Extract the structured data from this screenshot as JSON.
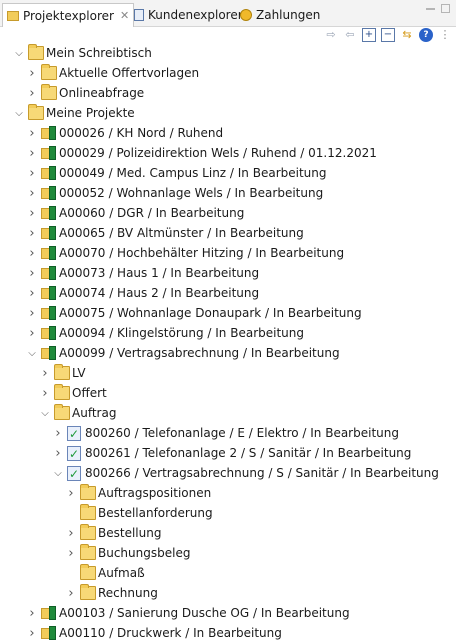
{
  "tabs": [
    {
      "label": "Projektexplorer",
      "active": true,
      "icon": "project-explorer-icon",
      "closable": true
    },
    {
      "label": "Kundenexplorer",
      "active": false,
      "icon": "customer-explorer-icon"
    },
    {
      "label": "Zahlungen",
      "active": false,
      "icon": "payments-icon"
    }
  ],
  "toolbar": {
    "icons": [
      "forward-arrow-icon",
      "back-arrow-icon",
      "expand-all-icon",
      "collapse-all-icon",
      "link-editor-icon",
      "help-icon",
      "view-menu-icon"
    ]
  },
  "tree": [
    {
      "level": 0,
      "expanded": true,
      "icon": "folder-open",
      "label": "Mein Schreibtisch"
    },
    {
      "level": 1,
      "expanded": false,
      "icon": "folder-open",
      "label": "Aktuelle Offertvorlagen"
    },
    {
      "level": 1,
      "expanded": false,
      "icon": "folder-open",
      "label": "Onlineabfrage"
    },
    {
      "level": 0,
      "expanded": true,
      "icon": "folder-open",
      "label": "Meine Projekte"
    },
    {
      "level": 1,
      "expanded": false,
      "icon": "project",
      "label": "000026 / KH Nord / Ruhend"
    },
    {
      "level": 1,
      "expanded": false,
      "icon": "project",
      "label": "000029 / Polizeidirektion Wels / Ruhend / 01.12.2021"
    },
    {
      "level": 1,
      "expanded": false,
      "icon": "project",
      "label": "000049 / Med. Campus Linz / In Bearbeitung"
    },
    {
      "level": 1,
      "expanded": false,
      "icon": "project",
      "label": "000052 / Wohnanlage Wels / In Bearbeitung"
    },
    {
      "level": 1,
      "expanded": false,
      "icon": "project",
      "label": "A00060 / DGR / In Bearbeitung"
    },
    {
      "level": 1,
      "expanded": false,
      "icon": "project",
      "label": "A00065 / BV Altmünster / In Bearbeitung"
    },
    {
      "level": 1,
      "expanded": false,
      "icon": "project",
      "label": "A00070 / Hochbehälter Hitzing / In Bearbeitung"
    },
    {
      "level": 1,
      "expanded": false,
      "icon": "project",
      "label": "A00073 / Haus 1 / In Bearbeitung"
    },
    {
      "level": 1,
      "expanded": false,
      "icon": "project",
      "label": "A00074 / Haus 2 / In Bearbeitung"
    },
    {
      "level": 1,
      "expanded": false,
      "icon": "project",
      "label": "A00075 / Wohnanlage Donaupark / In Bearbeitung"
    },
    {
      "level": 1,
      "expanded": false,
      "icon": "project",
      "label": "A00094 / Klingelstörung / In Bearbeitung"
    },
    {
      "level": 1,
      "expanded": true,
      "icon": "project",
      "label": "A00099 / Vertragsabrechnung / In Bearbeitung"
    },
    {
      "level": 2,
      "expanded": false,
      "icon": "folder-open",
      "label": "LV"
    },
    {
      "level": 2,
      "expanded": false,
      "icon": "folder-open",
      "label": "Offert"
    },
    {
      "level": 2,
      "expanded": true,
      "icon": "folder-open",
      "label": "Auftrag"
    },
    {
      "level": 3,
      "expanded": false,
      "icon": "order",
      "label": "800260 / Telefonanlage / E / Elektro / In Bearbeitung"
    },
    {
      "level": 3,
      "expanded": false,
      "icon": "order",
      "label": "800261 / Telefonanlage 2 / S / Sanitär / In Bearbeitung"
    },
    {
      "level": 3,
      "expanded": true,
      "icon": "order",
      "label": "800266 / Vertragsabrechnung / S / Sanitär / In Bearbeitung"
    },
    {
      "level": 4,
      "expanded": false,
      "icon": "folder-open",
      "label": "Auftragspositionen"
    },
    {
      "level": 4,
      "expanded": null,
      "icon": "folder-open",
      "label": "Bestellanforderung"
    },
    {
      "level": 4,
      "expanded": false,
      "icon": "folder-open",
      "label": "Bestellung"
    },
    {
      "level": 4,
      "expanded": false,
      "icon": "folder-open",
      "label": "Buchungsbeleg"
    },
    {
      "level": 4,
      "expanded": null,
      "icon": "folder-open",
      "label": "Aufmaß"
    },
    {
      "level": 4,
      "expanded": false,
      "icon": "folder-open",
      "label": "Rechnung"
    },
    {
      "level": 1,
      "expanded": false,
      "icon": "project",
      "label": "A00103 / Sanierung Dusche OG / In Bearbeitung"
    },
    {
      "level": 1,
      "expanded": false,
      "icon": "project",
      "label": "A00110 / Druckwerk / In Bearbeitung"
    }
  ]
}
